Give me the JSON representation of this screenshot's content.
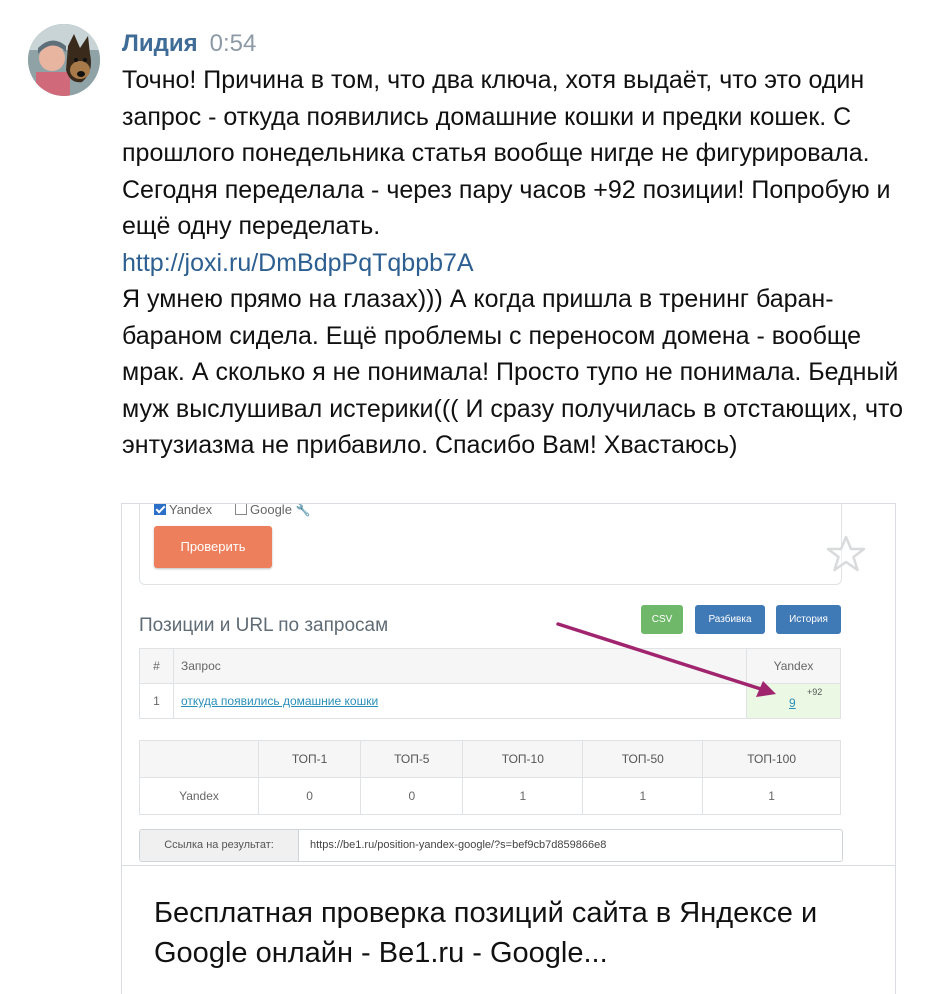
{
  "message": {
    "author": "Лидия",
    "time": "0:54",
    "paragraph1": "Точно! Причина в том, что два ключа, хотя выдаёт, что это один запрос - откуда появились домашние кошки и предки кошек. С прошлого понедельника статья вообще нигде не фигурировала. Сегодня переделала - через пару часов +92 позиции! Попробую и ещё одну переделать.",
    "link": "http://joxi.ru/DmBdpPqTqbpb7A",
    "paragraph2": "Я умнею прямо на глазах))) А когда пришла в тренинг баран-бараном сидела. Ещё проблемы с переносом домена - вообще мрак. А сколько я не понимала! Просто тупо не понимала. Бедный муж выслушивал истерики((( И сразу получилась в отстающих, что энтузиазма не прибавило. Спасибо Вам! Хвастаюсь)"
  },
  "preview": {
    "checkbox_yandex": "Yandex",
    "checkbox_google": "Google",
    "check_button": "Проверить",
    "section_title": "Позиции и URL по запросам",
    "buttons": {
      "csv": "CSV",
      "breakdown": "Разбивка",
      "history": "История"
    },
    "query_table": {
      "headers": [
        "#",
        "Запрос",
        "Yandex"
      ],
      "rows": [
        {
          "num": "1",
          "query": "откуда появились домашние кошки",
          "position": "9",
          "delta": "+92"
        }
      ]
    },
    "top_table": {
      "headers": [
        "",
        "ТОП-1",
        "ТОП-5",
        "ТОП-10",
        "ТОП-50",
        "ТОП-100"
      ],
      "row": [
        "Yandex",
        "0",
        "0",
        "1",
        "1",
        "1"
      ]
    },
    "result_link_label": "Ссылка на результат:",
    "result_link_value": "https://be1.ru/position-yandex-google/?s=bef9cb7d859866e8",
    "card_title": "Бесплатная проверка позиций сайта в Яндексе и Google онлайн - Be1.ru - Google..."
  },
  "icons": {
    "favorite": "star-icon",
    "settings": "wrench-icon"
  },
  "colors": {
    "author": "#3f6c96",
    "link": "#2d5f91",
    "check_button": "#ee7f5c",
    "csv": "#6fb86a",
    "blue_buttons": "#3f79b6",
    "arrow": "#a0256e"
  }
}
